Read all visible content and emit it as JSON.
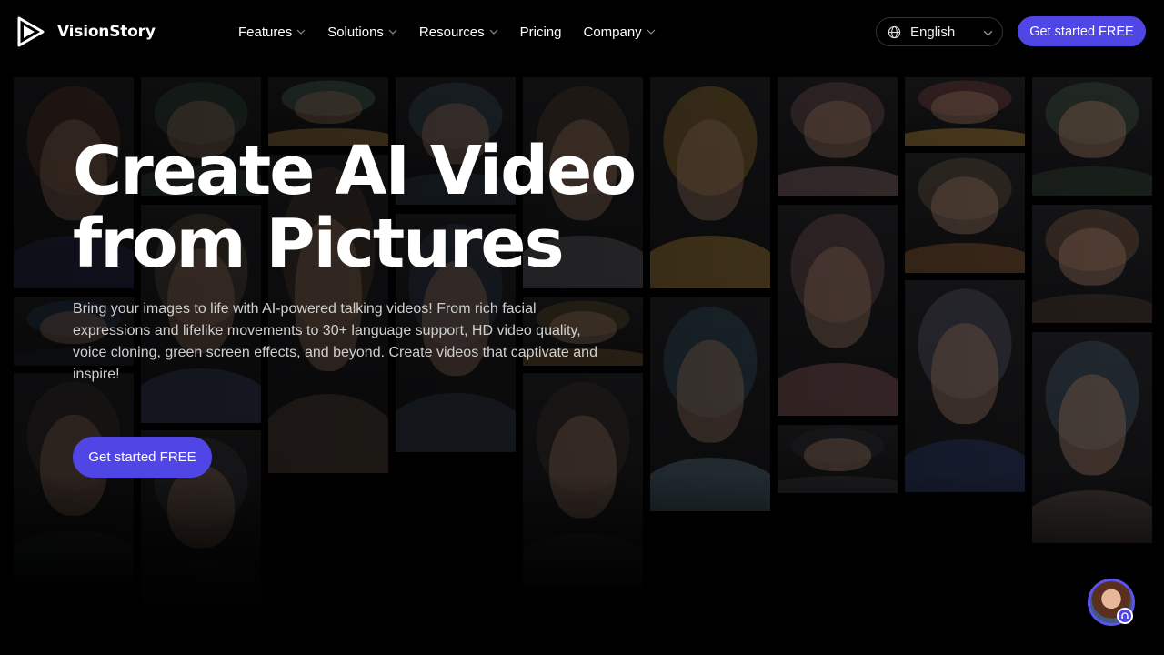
{
  "brand": {
    "name": "VisionStory",
    "accent": "#4f46e5"
  },
  "nav": {
    "items": [
      {
        "label": "Features",
        "has_dropdown": true
      },
      {
        "label": "Solutions",
        "has_dropdown": true
      },
      {
        "label": "Resources",
        "has_dropdown": true
      },
      {
        "label": "Pricing",
        "has_dropdown": false
      },
      {
        "label": "Company",
        "has_dropdown": true
      }
    ]
  },
  "language": {
    "selected": "English",
    "icon": "globe-icon"
  },
  "header_cta": {
    "label": "Get started FREE"
  },
  "hero": {
    "title_line1": "Create AI Video",
    "title_line2": "from Pictures",
    "description": "Bring your images to life with AI-powered talking videos! From rich facial expressions and lifelike movements to 30+ language support, HD video quality, voice cloning, green screen effects, and beyond. Create videos that captivate and inspire!",
    "cta_label": "Get started FREE"
  },
  "support_widget": {
    "icon": "headset-icon"
  }
}
